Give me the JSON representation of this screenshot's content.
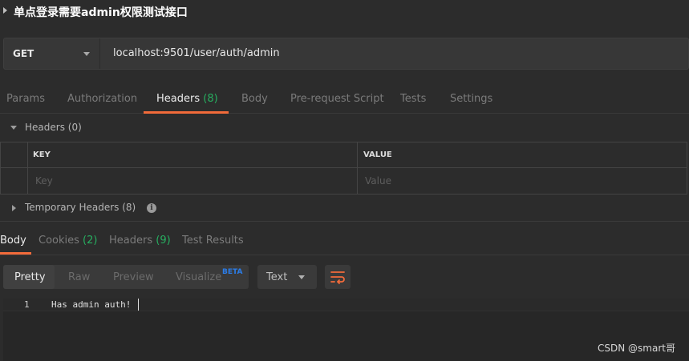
{
  "title": "单点登录需要admin权限测试接口",
  "request": {
    "method": "GET",
    "url": "localhost:9501/user/auth/admin"
  },
  "request_tabs": [
    {
      "label": "Params"
    },
    {
      "label": "Authorization"
    },
    {
      "label": "Headers",
      "count": "(8)"
    },
    {
      "label": "Body"
    },
    {
      "label": "Pre-request Script"
    },
    {
      "label": "Tests"
    },
    {
      "label": "Settings"
    }
  ],
  "headers_section": {
    "title": "Headers (0)",
    "columns": {
      "key": "KEY",
      "value": "VALUE"
    },
    "placeholders": {
      "key": "Key",
      "value": "Value"
    }
  },
  "temporary_headers": {
    "title": "Temporary Headers (8)",
    "icon": "info-icon"
  },
  "response_tabs": [
    {
      "label": "Body"
    },
    {
      "label": "Cookies",
      "count": "(2)"
    },
    {
      "label": "Headers",
      "count": "(9)"
    },
    {
      "label": "Test Results"
    }
  ],
  "view_modes": [
    "Pretty",
    "Raw",
    "Preview",
    "Visualize"
  ],
  "beta_badge": "BETA",
  "format": "Text",
  "wrap_icon": "wrap-lines-icon",
  "editor": {
    "line_number": "1",
    "text": "Has admin auth!"
  },
  "watermark": "CSDN @smart哥",
  "colors": {
    "accent": "#f26b3a",
    "count_green": "#27ae60",
    "beta_blue": "#2b7de9"
  }
}
